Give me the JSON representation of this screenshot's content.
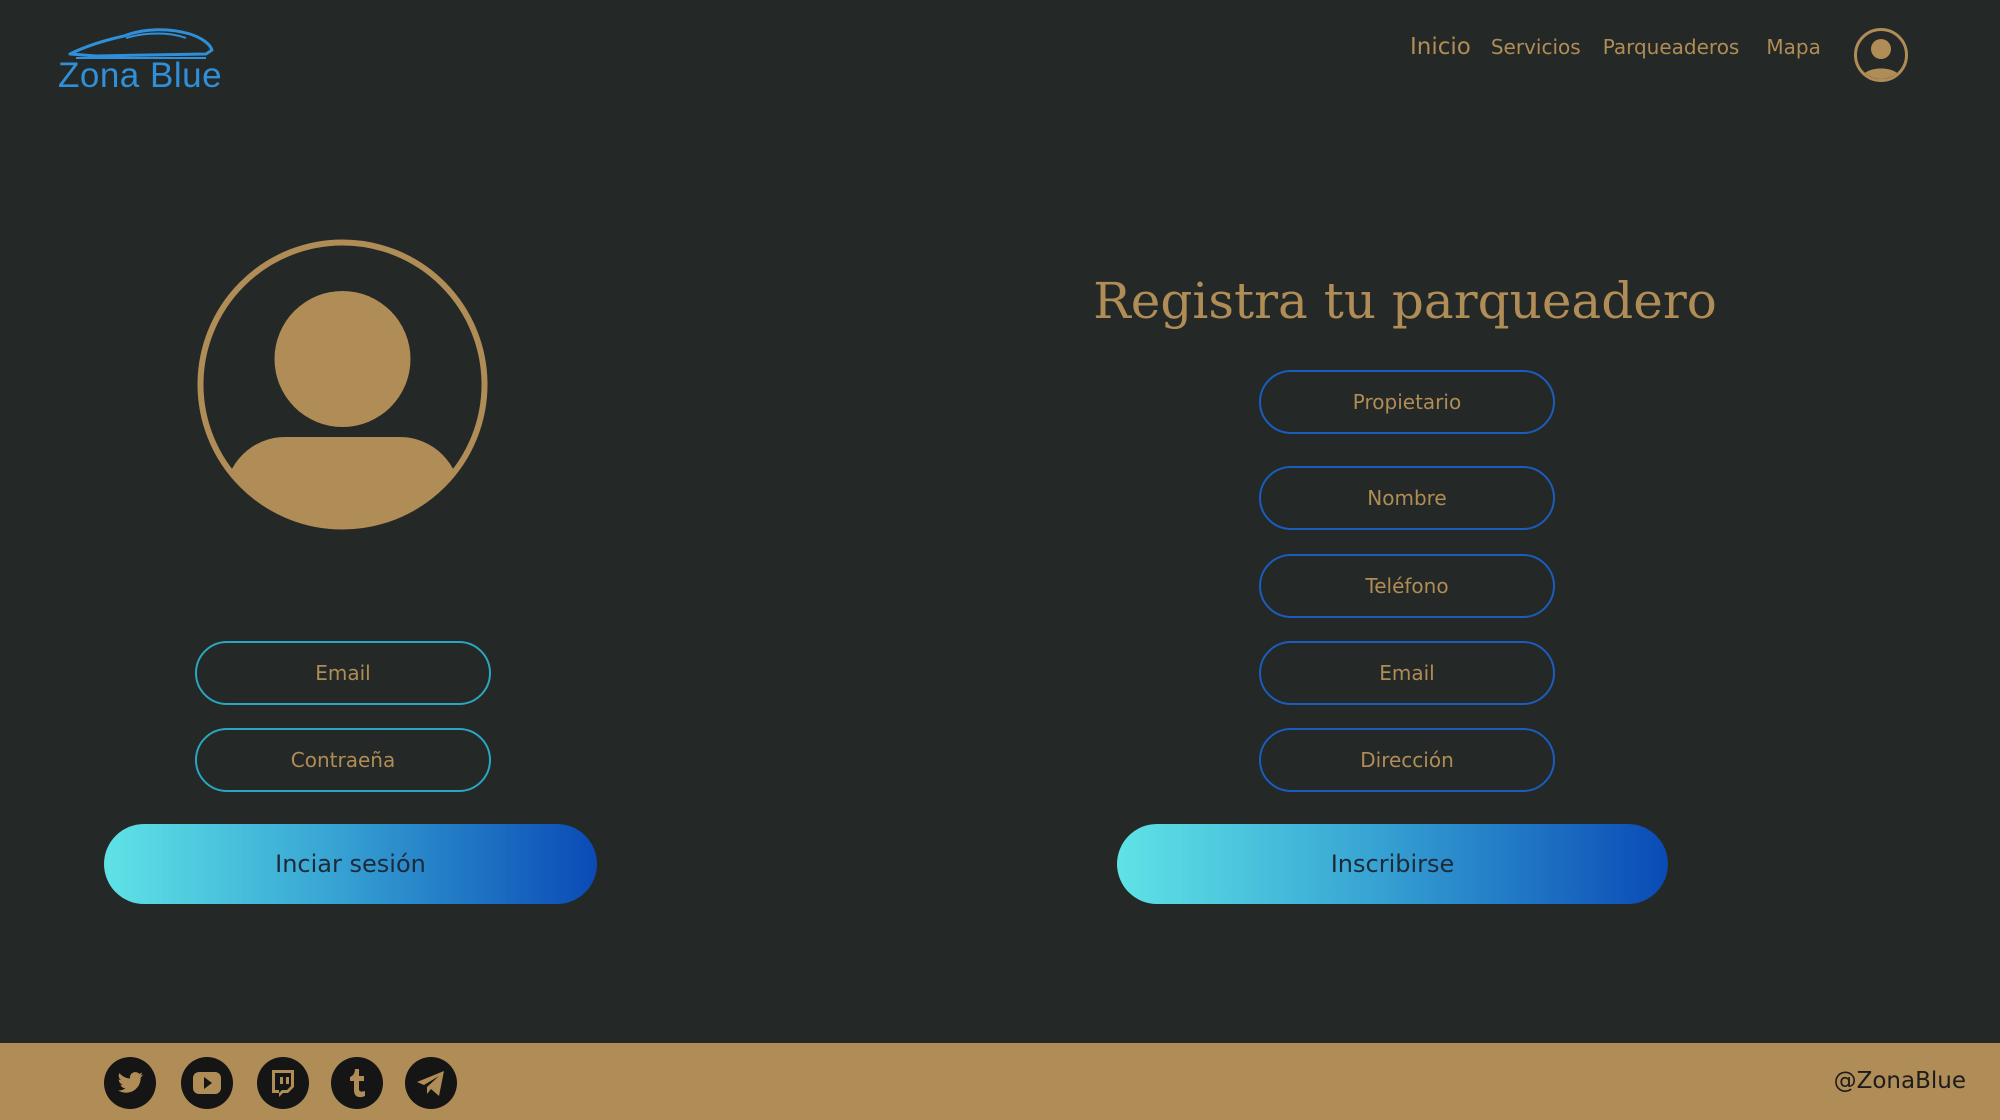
{
  "brand": {
    "name": "Zona Blue",
    "color": "#2f8fd8"
  },
  "nav": {
    "items": [
      "Inicio",
      "Servicios",
      "Parqueaderos",
      "Mapa"
    ]
  },
  "login": {
    "email_placeholder": "Email",
    "password_placeholder": "Contraeña",
    "submit_label": "Inciar sesión"
  },
  "register": {
    "title": "Registra tu parqueadero",
    "fields": [
      "Propietario",
      "Nombre",
      "Teléfono",
      "Email",
      "Dirección"
    ],
    "submit_label": "Inscribirse"
  },
  "footer": {
    "socials": [
      "twitter-icon",
      "youtube-icon",
      "twitch-icon",
      "tumblr-icon",
      "telegram-icon"
    ],
    "handle": "@ZonaBlue"
  },
  "colors": {
    "background": "#242826",
    "gold": "#b08c56",
    "gradient_start": "#5fe3e6",
    "gradient_end": "#0a4ab6"
  }
}
